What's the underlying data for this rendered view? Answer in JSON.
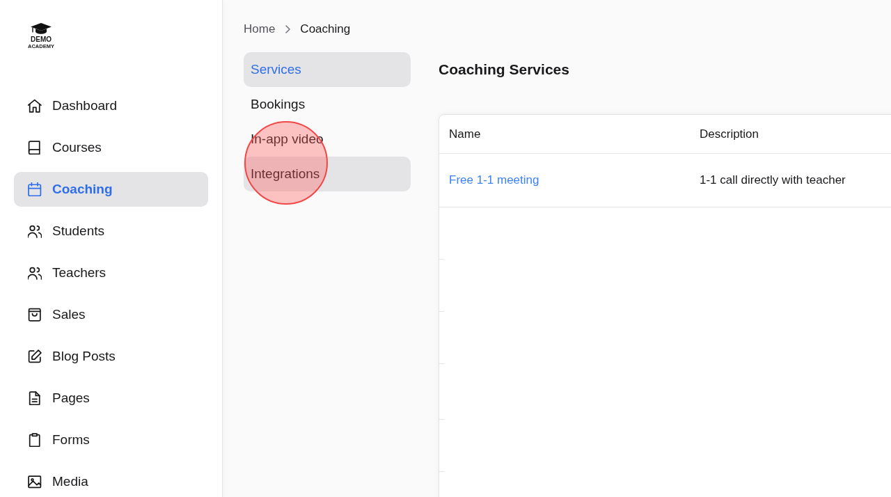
{
  "logo": {
    "title": "DEMO",
    "subtitle": "ACADEMY"
  },
  "sidebar": {
    "items": [
      {
        "label": "Dashboard",
        "selected": false
      },
      {
        "label": "Courses",
        "selected": false
      },
      {
        "label": "Coaching",
        "selected": true
      },
      {
        "label": "Students",
        "selected": false
      },
      {
        "label": "Teachers",
        "selected": false
      },
      {
        "label": "Sales",
        "selected": false
      },
      {
        "label": "Blog Posts",
        "selected": false
      },
      {
        "label": "Pages",
        "selected": false
      },
      {
        "label": "Forms",
        "selected": false
      },
      {
        "label": "Media",
        "selected": false
      }
    ]
  },
  "breadcrumb": [
    {
      "label": "Home",
      "current": false
    },
    {
      "label": "Coaching",
      "current": true
    }
  ],
  "subnav": {
    "items": [
      {
        "label": "Services",
        "selected": true,
        "hovered": false
      },
      {
        "label": "Bookings",
        "selected": false,
        "hovered": false
      },
      {
        "label": "In-app video",
        "selected": false,
        "hovered": false
      },
      {
        "label": "Integrations",
        "selected": false,
        "hovered": true
      }
    ]
  },
  "click_indicator": true,
  "page_title": "Coaching Services",
  "table": {
    "columns": [
      "Name",
      "Description"
    ],
    "rows": [
      {
        "name": "Free 1-1 meeting",
        "description": "1-1 call directly with teacher"
      }
    ]
  }
}
